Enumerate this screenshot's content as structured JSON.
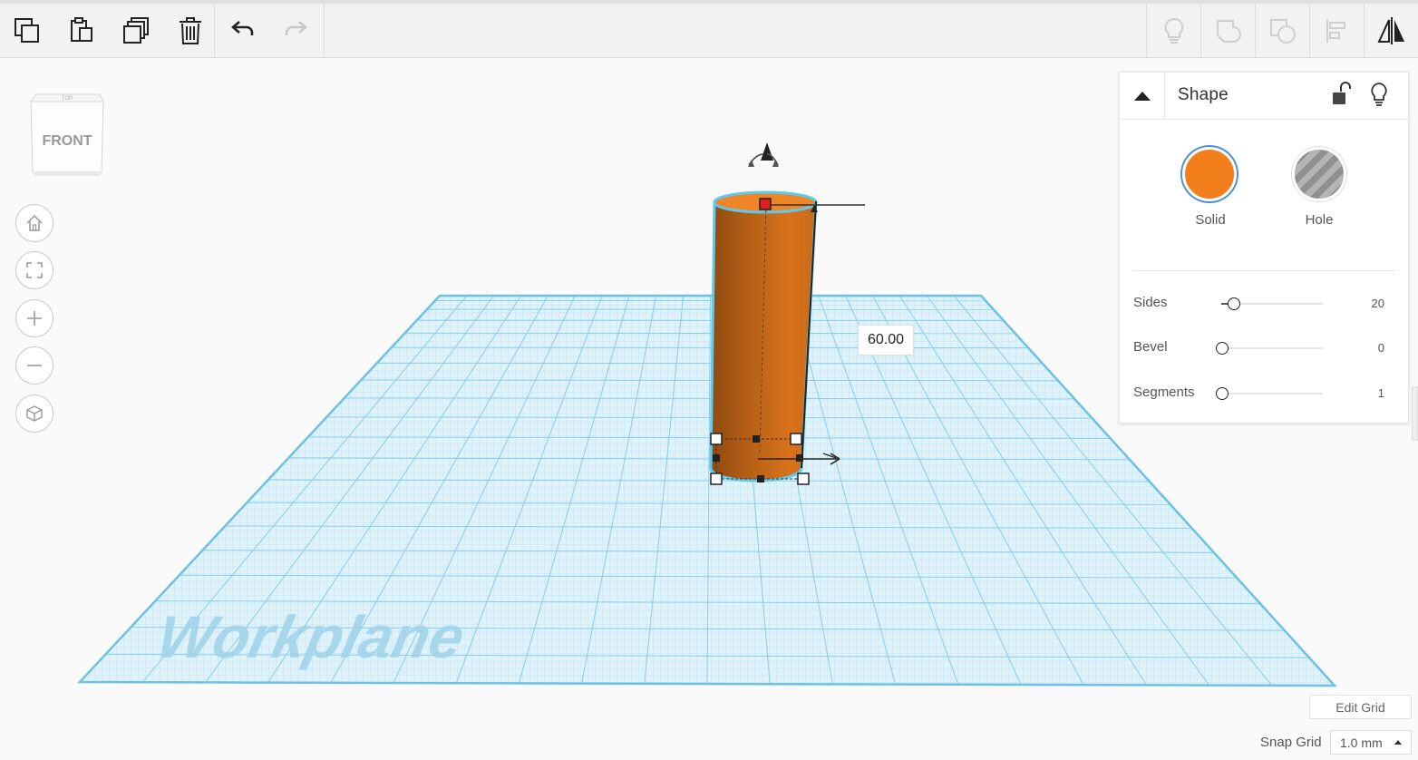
{
  "toolbar": {
    "left_tools": [
      {
        "name": "copy",
        "icon": "copy-icon"
      },
      {
        "name": "paste",
        "icon": "paste-icon"
      },
      {
        "name": "duplicate",
        "icon": "duplicate-icon"
      },
      {
        "name": "delete",
        "icon": "trash-icon"
      }
    ],
    "history": [
      {
        "name": "undo",
        "icon": "undo-icon"
      },
      {
        "name": "redo",
        "icon": "redo-icon"
      }
    ],
    "right_tools": [
      {
        "name": "show-all",
        "icon": "lightbulb-icon"
      },
      {
        "name": "group",
        "icon": "group-icon"
      },
      {
        "name": "ungroup",
        "icon": "ungroup-icon"
      },
      {
        "name": "align",
        "icon": "align-icon"
      },
      {
        "name": "mirror",
        "icon": "mirror-icon"
      }
    ]
  },
  "viewcube": {
    "top_label": "TOP",
    "front_label": "FRONT"
  },
  "nav_buttons": [
    "home-icon",
    "fit-view-icon",
    "zoom-in-icon",
    "zoom-out-icon",
    "ortho-view-icon"
  ],
  "workplane": {
    "label": "Workplane",
    "color": "#7cc8e6"
  },
  "shape": {
    "color": "#d9721a",
    "selection_outline": "#5ec9ec",
    "dimension_value": "60.00"
  },
  "inspector": {
    "title": "Shape",
    "solid_label": "Solid",
    "hole_label": "Hole",
    "solid_color": "#f27f1b",
    "properties": [
      {
        "label": "Sides",
        "value": "20",
        "min": 3,
        "max": 64,
        "current": 20
      },
      {
        "label": "Bevel",
        "value": "0",
        "min": 0,
        "max": 10,
        "current": 0
      },
      {
        "label": "Segments",
        "value": "1",
        "min": 1,
        "max": 10,
        "current": 1
      }
    ]
  },
  "footer": {
    "edit_grid_label": "Edit Grid",
    "snap_grid_label": "Snap Grid",
    "snap_grid_value": "1.0 mm"
  }
}
